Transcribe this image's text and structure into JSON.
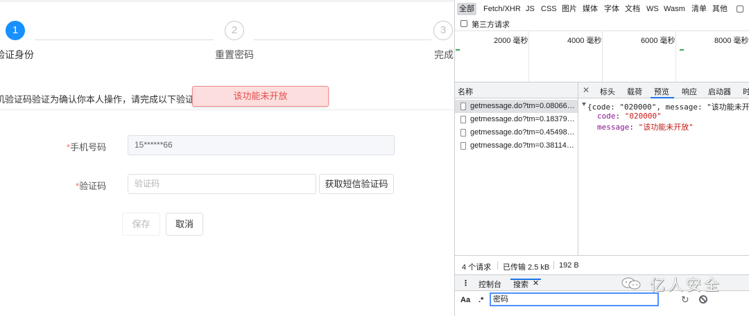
{
  "steps": [
    {
      "number": "1",
      "label": "验证身份",
      "state": "active"
    },
    {
      "number": "2",
      "label": "重置密码",
      "state": "idle"
    },
    {
      "number": "3",
      "label": "完成",
      "state": "idle"
    }
  ],
  "verify_notice": "机验证码验证为确认你本人操作，请完成以下验证",
  "toast": "该功能未开放",
  "form": {
    "phone_label_star": "*",
    "phone_label": "手机号码",
    "phone_value": "15******66",
    "code_label_star": "*",
    "code_label": "验证码",
    "code_placeholder": "验证码",
    "get_code_button": "获取短信验证码",
    "save_button": "保存",
    "cancel_button": "取消"
  },
  "devtools": {
    "filters": [
      "全部",
      "Fetch/XHR",
      "JS",
      "CSS",
      "图片",
      "媒体",
      "字体",
      "文档",
      "WS",
      "Wasm",
      "清单",
      "其他"
    ],
    "third_party_label": "第三方请求",
    "timeline_labels": [
      "2000 毫秒",
      "4000 毫秒",
      "6000 毫秒",
      "8000 毫秒"
    ],
    "list_header": "名称",
    "requests": [
      "getmessage.do?tm=0.08066…",
      "getmessage.do?tm=0.18379…",
      "getmessage.do?tm=0.45498…",
      "getmessage.do?tm=0.38114…"
    ],
    "detail_tabs": [
      "标头",
      "载荷",
      "预览",
      "响应",
      "启动器",
      "时"
    ],
    "active_detail_tab": "预览",
    "preview": {
      "summary": "{code: \"020000\", message: \"该功能未开放",
      "code_key": "code",
      "code_value": "\"020000\"",
      "message_key": "message",
      "message_value": "\"该功能未开放\""
    },
    "status": {
      "requests": "4 个请求",
      "transferred": "已传输 2.5 kB",
      "size": "192 B"
    },
    "drawer_tabs": [
      "控制台",
      "搜索"
    ],
    "active_drawer_tab": "搜索",
    "search": {
      "case_toggle": "Aa",
      "regex_toggle": ".*",
      "query": "密码"
    }
  },
  "watermark": "亿人安全",
  "colors": {
    "primary": "#1890ff",
    "error_text": "#e74c4c",
    "error_bg": "#fcdede",
    "devtools_accent": "#1a73e8"
  }
}
